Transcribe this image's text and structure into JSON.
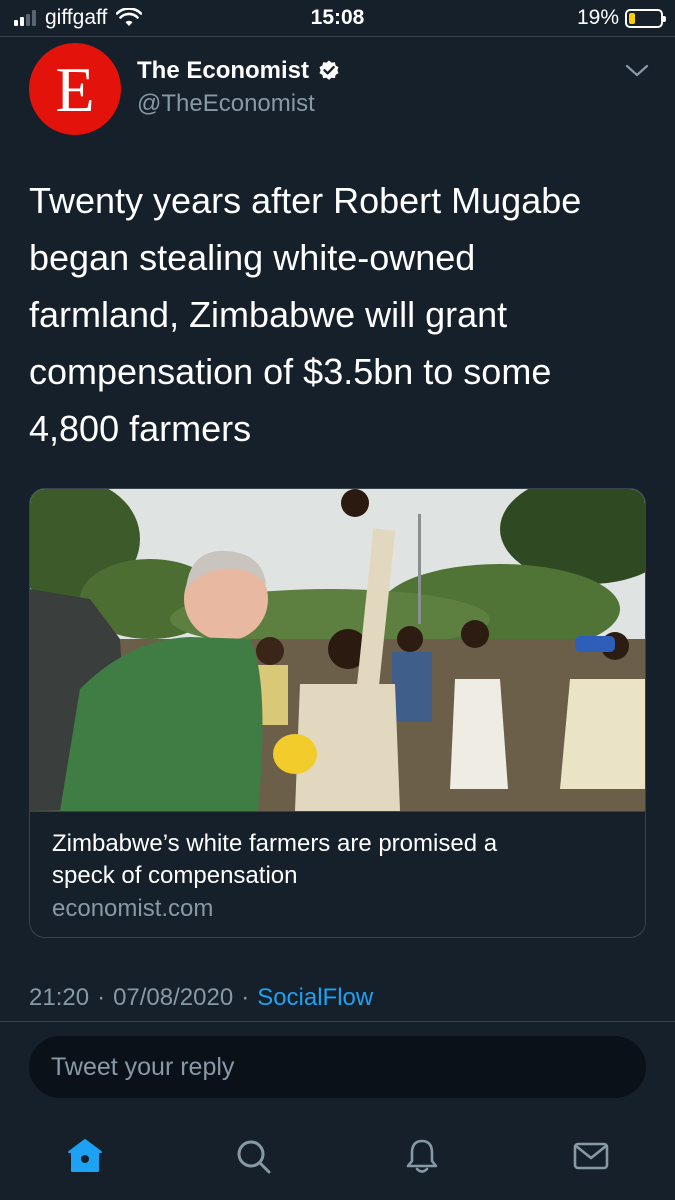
{
  "status_bar": {
    "carrier": "giffgaff",
    "time": "15:08",
    "battery_percent": "19%",
    "battery_level": 0.19,
    "signal_bars": 2,
    "colors": {
      "battery": "#ffcc00"
    }
  },
  "tweet": {
    "author": {
      "display_name": "The Economist",
      "handle": "@TheEconomist",
      "avatar_letter": "E",
      "verified": true,
      "avatar_color": "#e3120b"
    },
    "text_lines": [
      "Twenty years after Robert Mugabe",
      "began stealing white-owned",
      "farmland, Zimbabwe will grant",
      "compensation of $3.5bn to some",
      "4,800 farmers"
    ],
    "card": {
      "image_icon": "photo-farmers",
      "title_lines": [
        "Zimbabwe’s white farmers are promised a",
        "speck of compensation"
      ],
      "domain": "economist.com"
    },
    "time": "21:20",
    "separator": "·",
    "date": "07/08/2020",
    "source": "SocialFlow"
  },
  "reply": {
    "placeholder": "Tweet your reply"
  },
  "tab_bar": {
    "items": [
      {
        "icon": "home-icon",
        "active": true
      },
      {
        "icon": "search-icon",
        "active": false
      },
      {
        "icon": "bell-icon",
        "active": false
      },
      {
        "icon": "mail-icon",
        "active": false
      }
    ]
  },
  "colors": {
    "background": "#15202b",
    "accent": "#1da1f2",
    "secondary_text": "#8899a6",
    "divider": "#38444d"
  }
}
